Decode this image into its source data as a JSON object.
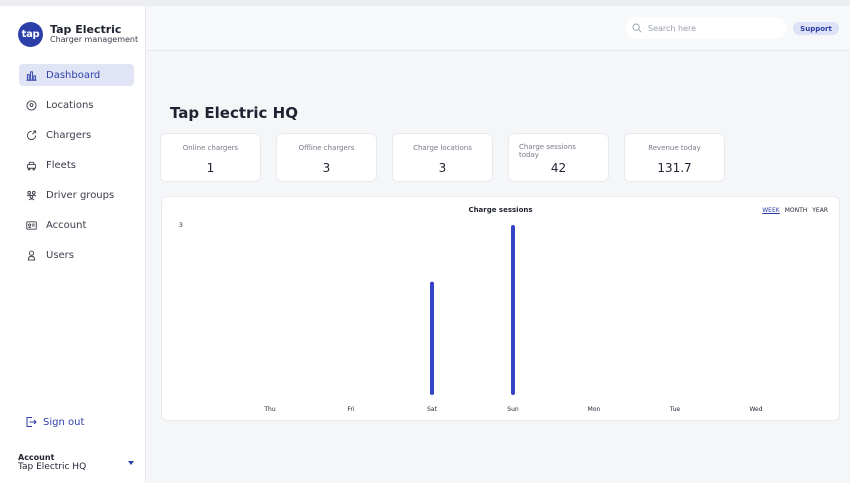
{
  "brand": {
    "logo_text": "tap",
    "title": "Tap Electric",
    "subtitle": "Charger management"
  },
  "sidebar": {
    "items": [
      {
        "label": "Dashboard",
        "icon": "bar-chart-icon",
        "active": true
      },
      {
        "label": "Locations",
        "icon": "location-pin-icon",
        "active": false
      },
      {
        "label": "Chargers",
        "icon": "charger-icon",
        "active": false
      },
      {
        "label": "Fleets",
        "icon": "car-icon",
        "active": false
      },
      {
        "label": "Driver groups",
        "icon": "group-icon",
        "active": false
      },
      {
        "label": "Account",
        "icon": "id-card-icon",
        "active": false
      },
      {
        "label": "Users",
        "icon": "user-icon",
        "active": false
      }
    ],
    "sign_out": "Sign out",
    "account_title": "Account",
    "account_value": "Tap Electric HQ"
  },
  "header": {
    "search_placeholder": "Search here",
    "support_label": "Support"
  },
  "main": {
    "title": "Tap Electric HQ",
    "cards": [
      {
        "label": "Online chargers",
        "value": "1"
      },
      {
        "label": "Offline chargers",
        "value": "3"
      },
      {
        "label": "Charge locations",
        "value": "3"
      },
      {
        "label": "Charge sessions today",
        "value": "42"
      },
      {
        "label": "Revenue today",
        "value": "131.7"
      }
    ]
  },
  "periods": [
    "WEEK",
    "MONTH",
    "YEAR"
  ],
  "colors": {
    "accent": "#2c3fa9",
    "bar": "#3344c4",
    "active_nav_bg": "#e1e4f5"
  },
  "chart_data": {
    "type": "bar",
    "title": "Charge sessions",
    "categories": [
      "Thu",
      "Fri",
      "Sat",
      "Sun",
      "Mon",
      "Tue",
      "Wed"
    ],
    "values": [
      0,
      0,
      2,
      3,
      0,
      0,
      0
    ],
    "ylim": [
      0,
      3
    ],
    "ytick_labels": [
      "3"
    ],
    "grid": false,
    "legend": "none"
  }
}
